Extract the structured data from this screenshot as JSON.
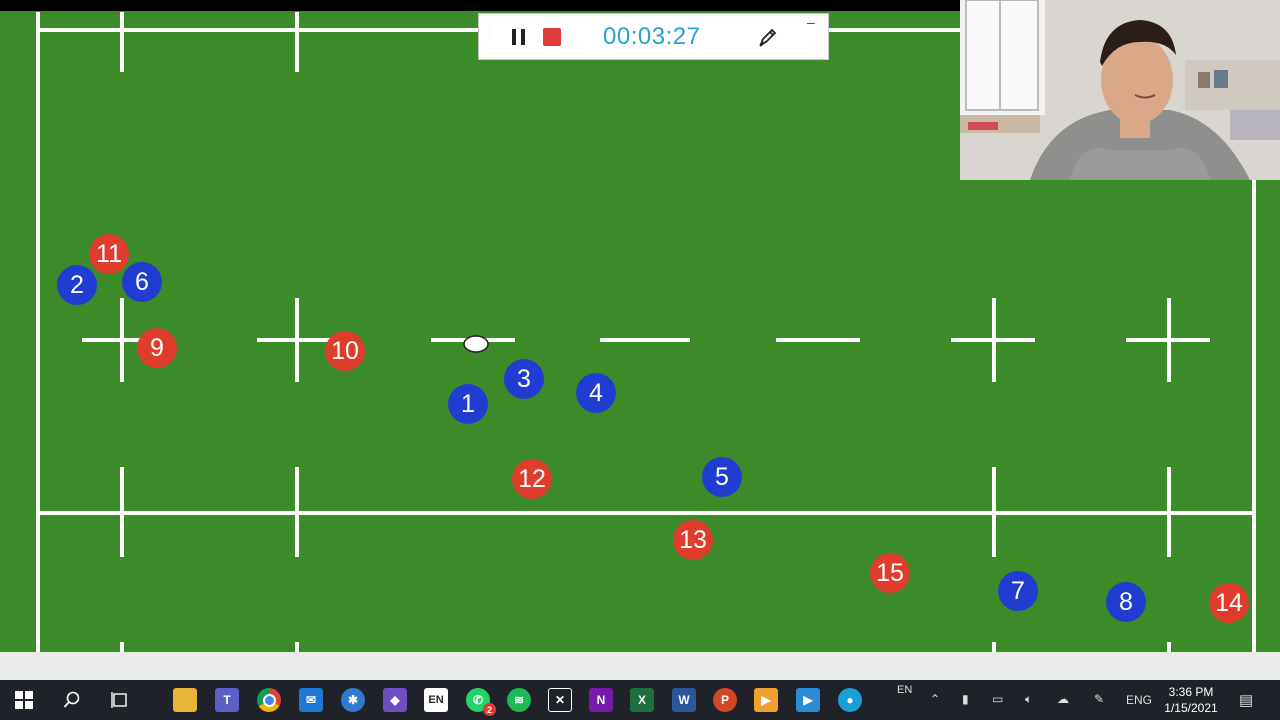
{
  "recorder": {
    "timer": "00:03:27",
    "pause_label": "Pause recording",
    "stop_label": "Stop recording",
    "pen_label": "Draw",
    "minimize_glyph": "–"
  },
  "players": {
    "red": [
      "11",
      "9",
      "10",
      "12",
      "13",
      "15",
      "14"
    ],
    "blue": [
      "2",
      "6",
      "3",
      "4",
      "1",
      "5",
      "7",
      "8"
    ]
  },
  "colors": {
    "pitch": "#3b8b29",
    "red_team": "#e03c2c",
    "blue_team": "#1f3ed1",
    "timer": "#2aa1c7"
  },
  "taskbar": {
    "input_lang_badge": "EN",
    "lang_indicator": "EN",
    "keyboard_lang": "ENG",
    "whatsapp_badge": "2",
    "time": "3:36 PM",
    "date": "1/15/2021",
    "apps": [
      "start-icon",
      "search-icon",
      "task-view-icon",
      "file-explorer-icon",
      "teams-icon",
      "chrome-icon",
      "mail-icon",
      "app-icon",
      "visual-studio-icon",
      "language-icon",
      "whatsapp-icon",
      "spotify-icon",
      "mail-app-icon",
      "onenote-icon",
      "excel-icon",
      "word-icon",
      "powerpoint-icon",
      "media-player-icon",
      "screen-recorder-icon",
      "camera-icon"
    ]
  }
}
